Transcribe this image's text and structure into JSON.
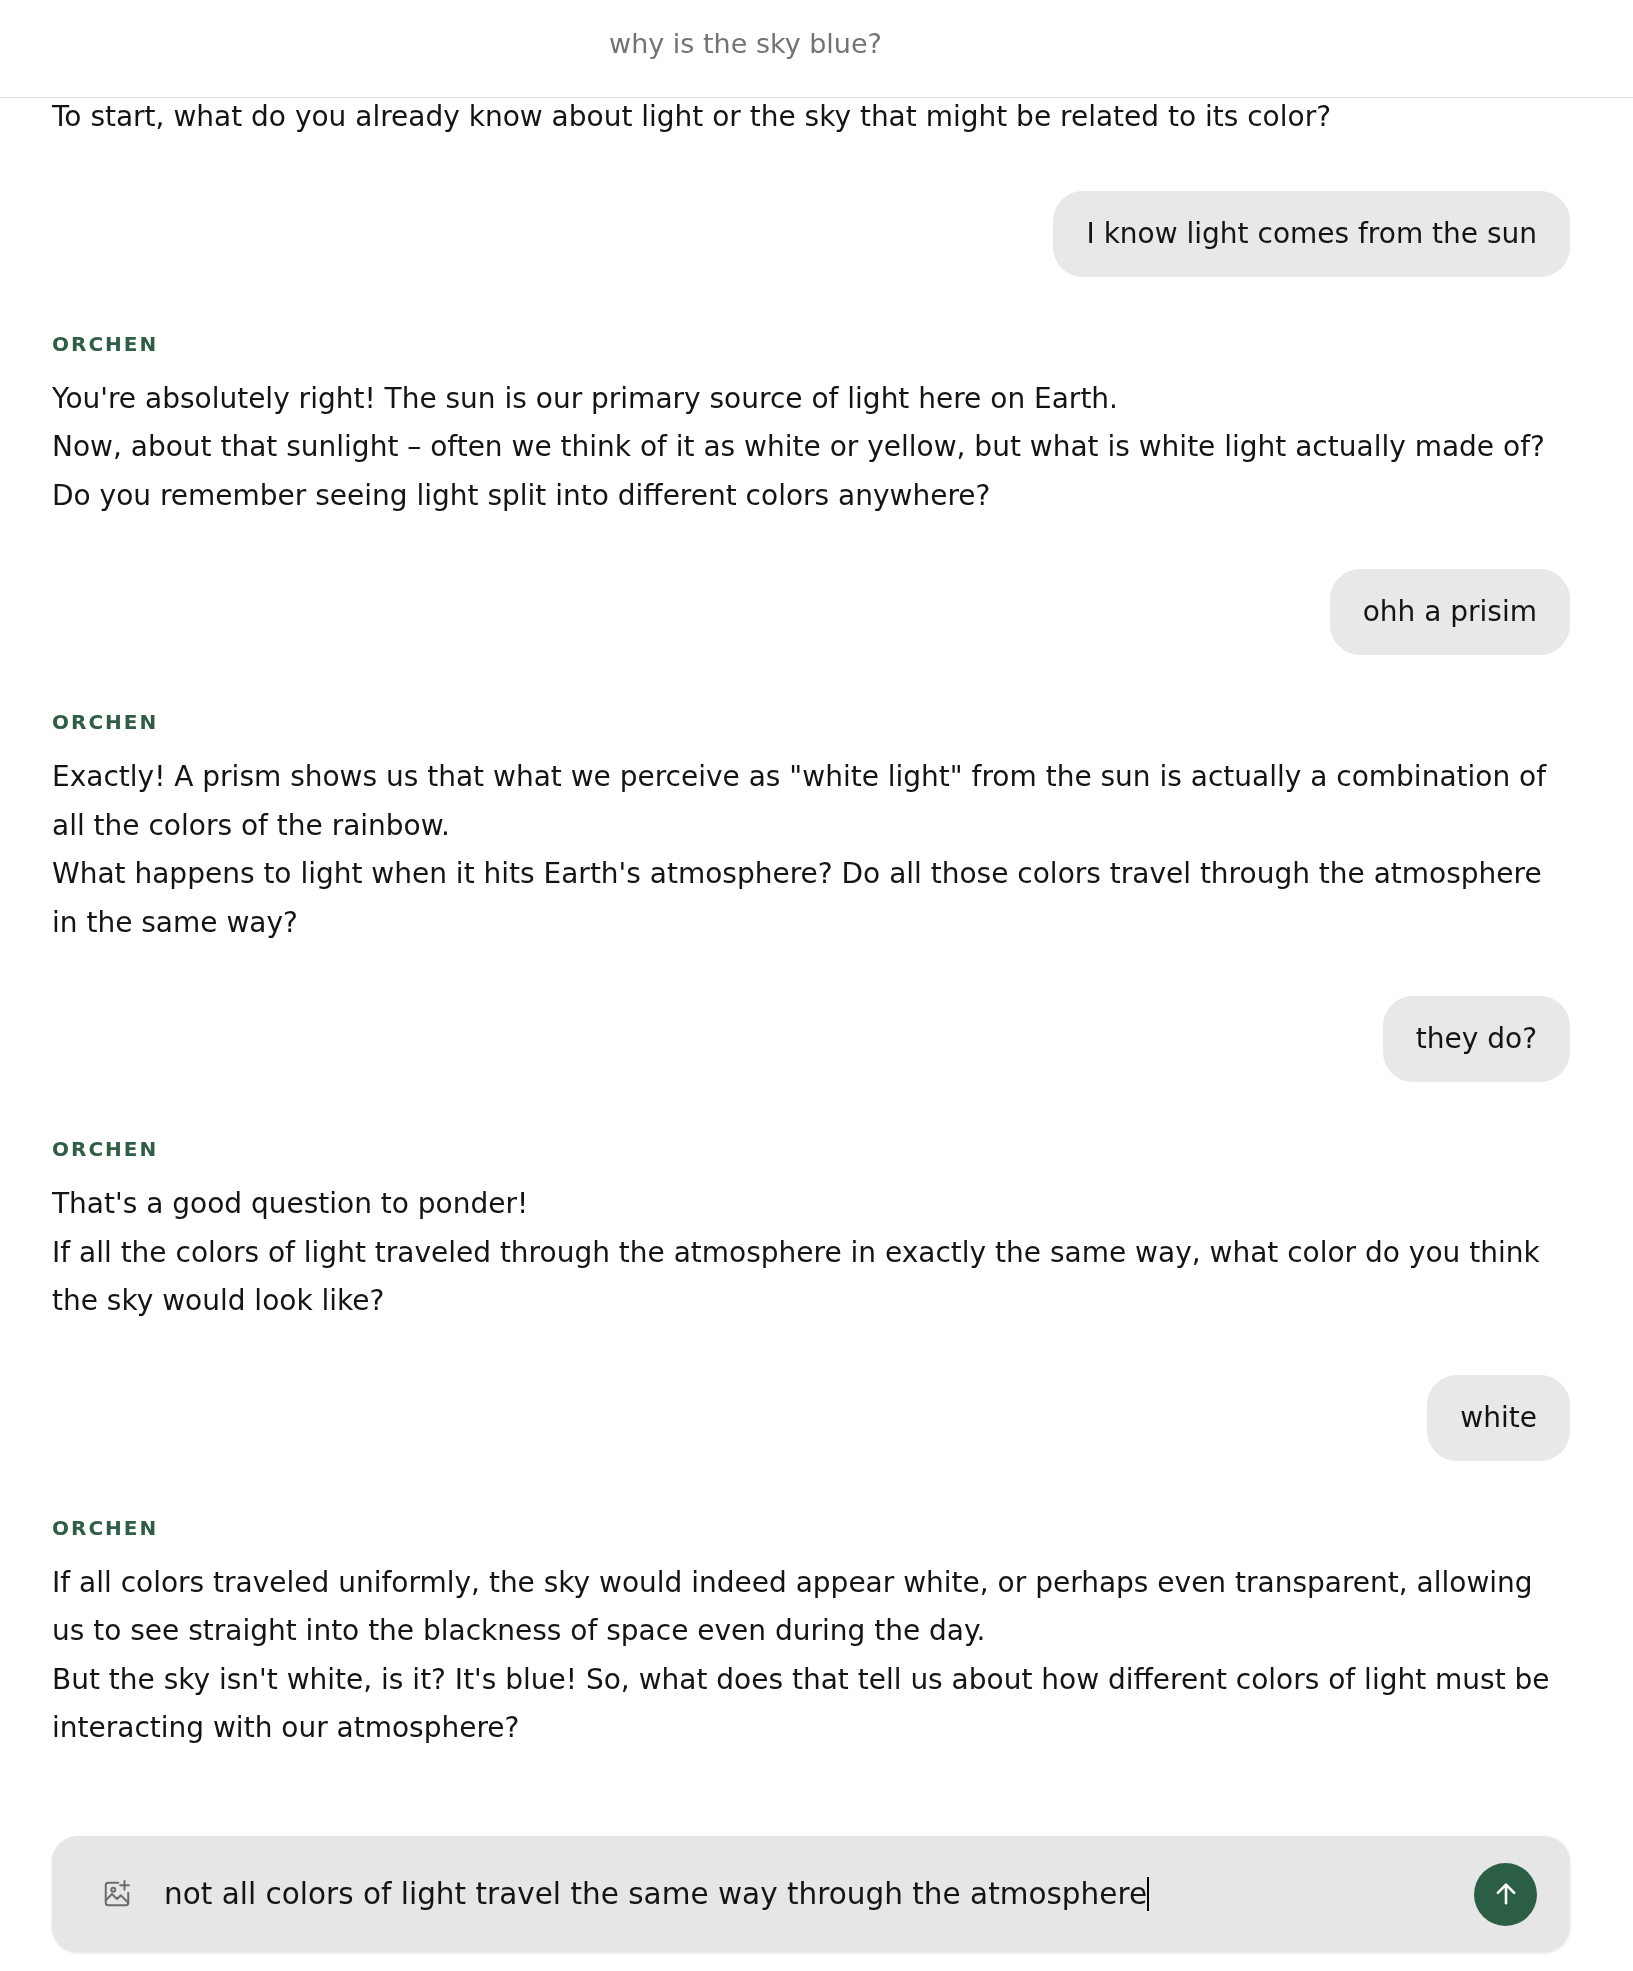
{
  "header": {
    "title": "why is the sky blue?"
  },
  "messages": [
    {
      "kind": "assistant",
      "paragraphs": [
        "To start, what do you already know about light or the sky that might be related to its color?"
      ]
    },
    {
      "kind": "user",
      "text": "I know light comes from the sun"
    },
    {
      "kind": "assistant",
      "sender": "ORCHEN",
      "paragraphs": [
        "You're absolutely right! The sun is our primary source of light here on Earth.",
        "Now, about that sunlight – often we think of it as white or yellow, but what is white light actually made of?",
        "Do you remember seeing light split into different colors anywhere?"
      ]
    },
    {
      "kind": "user",
      "text": "ohh a prisim"
    },
    {
      "kind": "assistant",
      "sender": "ORCHEN",
      "paragraphs": [
        "Exactly! A prism shows us that what we perceive as \"white light\" from the sun is actually a combination of all the colors of the rainbow.",
        "What happens to light when it hits Earth's atmosphere? Do all those colors travel through the atmosphere in the same way?"
      ]
    },
    {
      "kind": "user",
      "text": "they do?"
    },
    {
      "kind": "assistant",
      "sender": "ORCHEN",
      "paragraphs": [
        "That's a good question to ponder!",
        "If all the colors of light traveled through the atmosphere in exactly the same way, what color do you think the sky would look like?"
      ]
    },
    {
      "kind": "user",
      "text": "white"
    },
    {
      "kind": "assistant",
      "sender": "ORCHEN",
      "paragraphs": [
        "If all colors traveled uniformly, the sky would indeed appear white, or perhaps even transparent, allowing us to see straight into the blackness of space even during the day.",
        "But the sky isn't white, is it? It's blue! So, what does that tell us about how different colors of light must be interacting with our atmosphere?"
      ]
    }
  ],
  "composer": {
    "value": "not all colors of light travel the same way through the atmosphere",
    "focused": true
  }
}
